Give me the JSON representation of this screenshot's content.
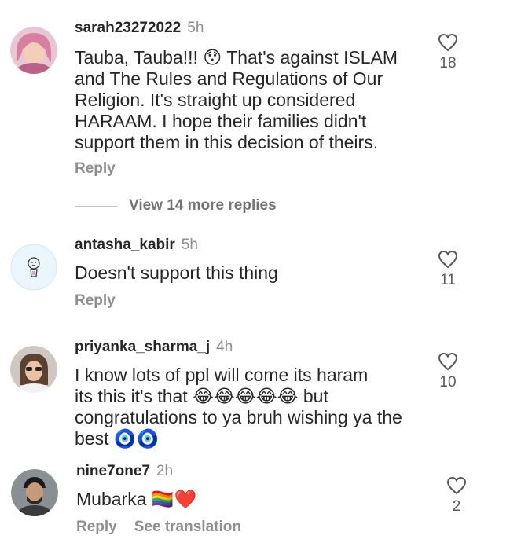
{
  "comments": [
    {
      "username": "sarah23272022",
      "time": "5h",
      "text_lines": [
        "Tauba, Tauba!!! 😯 That's against ISLAM",
        "and The Rules and Regulations of Our",
        "Religion. It's straight up considered",
        "HARAAM. I hope their families didn't",
        "support them in this decision of theirs."
      ],
      "reply": "Reply",
      "likes": "18"
    },
    {
      "username": "antasha_kabir",
      "time": "5h",
      "text_lines": [
        "Doesn't support this thing"
      ],
      "reply": "Reply",
      "likes": "11"
    },
    {
      "username": "priyanka_sharma_j",
      "time": "4h",
      "text_lines": [
        "I know lots of ppl will come its haram",
        "its this it's that 😂😂😂😂😂 but",
        "congratulations to ya bruh wishing ya the",
        "best 🧿🧿"
      ],
      "likes": "10"
    },
    {
      "username": "nine7one7",
      "time": "2h",
      "text_lines": [
        "Mubarka 🏳️‍🌈❤️"
      ],
      "reply": "Reply",
      "see_translation": "See translation",
      "likes": "2"
    }
  ],
  "view_replies": "View 14 more replies"
}
